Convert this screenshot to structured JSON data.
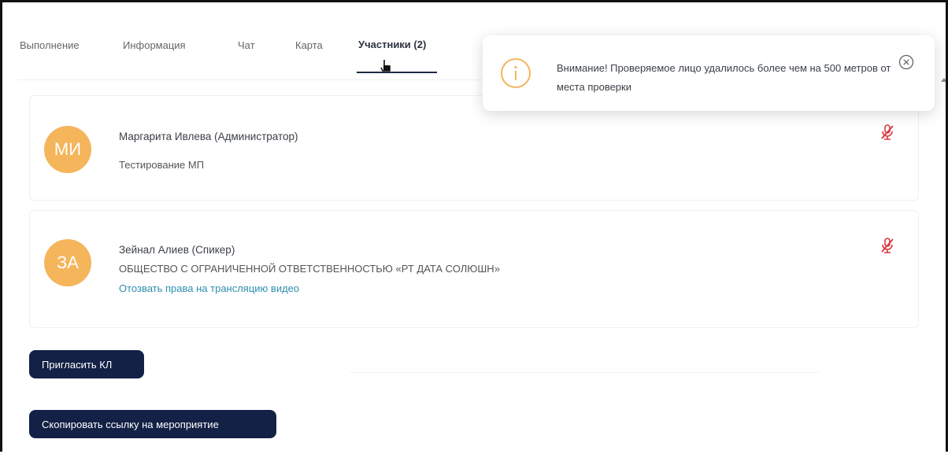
{
  "tabs": [
    {
      "label": "Выполнение"
    },
    {
      "label": "Информация"
    },
    {
      "label": "Чат"
    },
    {
      "label": "Карта"
    },
    {
      "label": "Участники (2)"
    }
  ],
  "participants": [
    {
      "initials": "МИ",
      "name": "Маргарита Ивлева (Администратор)",
      "org": "Тестирование МП",
      "mic_icon": "mic-off-icon"
    },
    {
      "initials": "ЗА",
      "name": "Зейнал Алиев (Спикер)",
      "org": "ОБЩЕСТВО С ОГРАНИЧЕННОЙ ОТВЕТСТВЕННОСТЬЮ «РТ ДАТА СОЛЮШН»",
      "action": "Отозвать права на трансляцию видео",
      "mic_icon": "mic-off-icon"
    }
  ],
  "buttons": {
    "invite": "Пригласить КЛ",
    "copy_link": "Скопировать ссылку на мероприятие"
  },
  "toast": {
    "message": "Внимание! Проверяемое лицо удалилось более чем на 500 метров от места проверки",
    "icon": "info-icon"
  },
  "colors": {
    "avatar": "#f4b55b",
    "button": "#132146",
    "link": "#2e8fb0",
    "mic_off": "#d9363e",
    "warning": "#f4b55b"
  }
}
